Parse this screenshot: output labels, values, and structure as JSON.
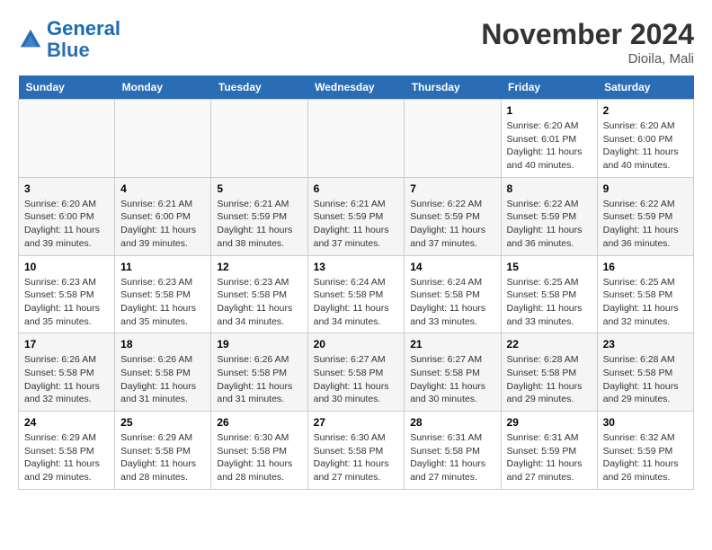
{
  "logo": {
    "line1": "General",
    "line2": "Blue"
  },
  "title": "November 2024",
  "location": "Dioila, Mali",
  "days_of_week": [
    "Sunday",
    "Monday",
    "Tuesday",
    "Wednesday",
    "Thursday",
    "Friday",
    "Saturday"
  ],
  "weeks": [
    [
      {
        "day": "",
        "info": ""
      },
      {
        "day": "",
        "info": ""
      },
      {
        "day": "",
        "info": ""
      },
      {
        "day": "",
        "info": ""
      },
      {
        "day": "",
        "info": ""
      },
      {
        "day": "1",
        "info": "Sunrise: 6:20 AM\nSunset: 6:01 PM\nDaylight: 11 hours and 40 minutes."
      },
      {
        "day": "2",
        "info": "Sunrise: 6:20 AM\nSunset: 6:00 PM\nDaylight: 11 hours and 40 minutes."
      }
    ],
    [
      {
        "day": "3",
        "info": "Sunrise: 6:20 AM\nSunset: 6:00 PM\nDaylight: 11 hours and 39 minutes."
      },
      {
        "day": "4",
        "info": "Sunrise: 6:21 AM\nSunset: 6:00 PM\nDaylight: 11 hours and 39 minutes."
      },
      {
        "day": "5",
        "info": "Sunrise: 6:21 AM\nSunset: 5:59 PM\nDaylight: 11 hours and 38 minutes."
      },
      {
        "day": "6",
        "info": "Sunrise: 6:21 AM\nSunset: 5:59 PM\nDaylight: 11 hours and 37 minutes."
      },
      {
        "day": "7",
        "info": "Sunrise: 6:22 AM\nSunset: 5:59 PM\nDaylight: 11 hours and 37 minutes."
      },
      {
        "day": "8",
        "info": "Sunrise: 6:22 AM\nSunset: 5:59 PM\nDaylight: 11 hours and 36 minutes."
      },
      {
        "day": "9",
        "info": "Sunrise: 6:22 AM\nSunset: 5:59 PM\nDaylight: 11 hours and 36 minutes."
      }
    ],
    [
      {
        "day": "10",
        "info": "Sunrise: 6:23 AM\nSunset: 5:58 PM\nDaylight: 11 hours and 35 minutes."
      },
      {
        "day": "11",
        "info": "Sunrise: 6:23 AM\nSunset: 5:58 PM\nDaylight: 11 hours and 35 minutes."
      },
      {
        "day": "12",
        "info": "Sunrise: 6:23 AM\nSunset: 5:58 PM\nDaylight: 11 hours and 34 minutes."
      },
      {
        "day": "13",
        "info": "Sunrise: 6:24 AM\nSunset: 5:58 PM\nDaylight: 11 hours and 34 minutes."
      },
      {
        "day": "14",
        "info": "Sunrise: 6:24 AM\nSunset: 5:58 PM\nDaylight: 11 hours and 33 minutes."
      },
      {
        "day": "15",
        "info": "Sunrise: 6:25 AM\nSunset: 5:58 PM\nDaylight: 11 hours and 33 minutes."
      },
      {
        "day": "16",
        "info": "Sunrise: 6:25 AM\nSunset: 5:58 PM\nDaylight: 11 hours and 32 minutes."
      }
    ],
    [
      {
        "day": "17",
        "info": "Sunrise: 6:26 AM\nSunset: 5:58 PM\nDaylight: 11 hours and 32 minutes."
      },
      {
        "day": "18",
        "info": "Sunrise: 6:26 AM\nSunset: 5:58 PM\nDaylight: 11 hours and 31 minutes."
      },
      {
        "day": "19",
        "info": "Sunrise: 6:26 AM\nSunset: 5:58 PM\nDaylight: 11 hours and 31 minutes."
      },
      {
        "day": "20",
        "info": "Sunrise: 6:27 AM\nSunset: 5:58 PM\nDaylight: 11 hours and 30 minutes."
      },
      {
        "day": "21",
        "info": "Sunrise: 6:27 AM\nSunset: 5:58 PM\nDaylight: 11 hours and 30 minutes."
      },
      {
        "day": "22",
        "info": "Sunrise: 6:28 AM\nSunset: 5:58 PM\nDaylight: 11 hours and 29 minutes."
      },
      {
        "day": "23",
        "info": "Sunrise: 6:28 AM\nSunset: 5:58 PM\nDaylight: 11 hours and 29 minutes."
      }
    ],
    [
      {
        "day": "24",
        "info": "Sunrise: 6:29 AM\nSunset: 5:58 PM\nDaylight: 11 hours and 29 minutes."
      },
      {
        "day": "25",
        "info": "Sunrise: 6:29 AM\nSunset: 5:58 PM\nDaylight: 11 hours and 28 minutes."
      },
      {
        "day": "26",
        "info": "Sunrise: 6:30 AM\nSunset: 5:58 PM\nDaylight: 11 hours and 28 minutes."
      },
      {
        "day": "27",
        "info": "Sunrise: 6:30 AM\nSunset: 5:58 PM\nDaylight: 11 hours and 27 minutes."
      },
      {
        "day": "28",
        "info": "Sunrise: 6:31 AM\nSunset: 5:58 PM\nDaylight: 11 hours and 27 minutes."
      },
      {
        "day": "29",
        "info": "Sunrise: 6:31 AM\nSunset: 5:59 PM\nDaylight: 11 hours and 27 minutes."
      },
      {
        "day": "30",
        "info": "Sunrise: 6:32 AM\nSunset: 5:59 PM\nDaylight: 11 hours and 26 minutes."
      }
    ]
  ]
}
